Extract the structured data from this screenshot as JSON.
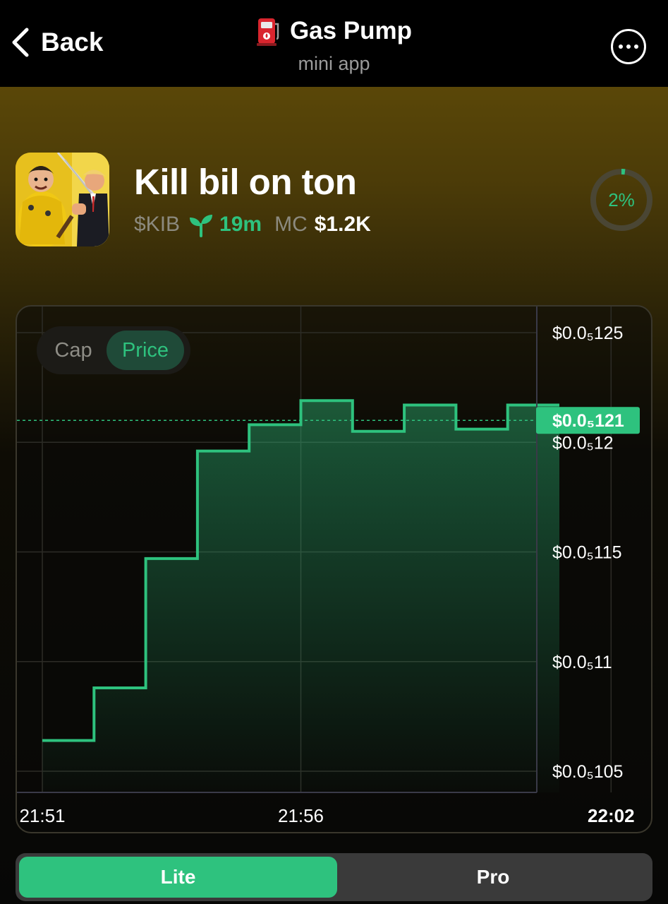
{
  "header": {
    "back_label": "Back",
    "title": "Gas Pump",
    "subtitle": "mini app"
  },
  "token": {
    "name": "Kill bil on ton",
    "ticker": "$KIB",
    "age": "19m",
    "mc_label": "MC",
    "mc_value": "$1.2K",
    "progress_label": "2%",
    "progress": 0.02
  },
  "chart_toggle": {
    "cap_label": "Cap",
    "price_label": "Price",
    "selected": "Price"
  },
  "chart_data": {
    "type": "line",
    "style": "step",
    "y_tick_labels": [
      "$0.0₅125",
      "$0.0₅12",
      "$0.0₅115",
      "$0.0₅11",
      "$0.0₅105"
    ],
    "y_ticks": [
      1.25e-06,
      1.2e-06,
      1.15e-06,
      1.1e-06,
      1.05e-06
    ],
    "current_price_label": "$0.0₅121",
    "current_price": 1.21e-06,
    "x_tick_labels": [
      "21:51",
      "21:56",
      "22:02"
    ],
    "x_ticks": [
      0,
      5,
      11
    ],
    "x_unit": "minutes after 21:51",
    "ylim": [
      1.04e-06,
      1.265e-06
    ],
    "xlim": [
      0,
      14.1
    ],
    "points_x": [
      0,
      1,
      2,
      3,
      4,
      5,
      6,
      7,
      8,
      9,
      10
    ],
    "points_y": [
      1.064e-06,
      1.088e-06,
      1.147e-06,
      1.196e-06,
      1.208e-06,
      1.219e-06,
      1.205e-06,
      1.217e-06,
      1.206e-06,
      1.217e-06
    ],
    "line_color": "#2ec27e",
    "grid": true
  },
  "mode_toggle": {
    "lite_label": "Lite",
    "pro_label": "Pro",
    "selected": "Lite"
  },
  "colors": {
    "accent": "#2ec27e",
    "background": "#000000"
  }
}
